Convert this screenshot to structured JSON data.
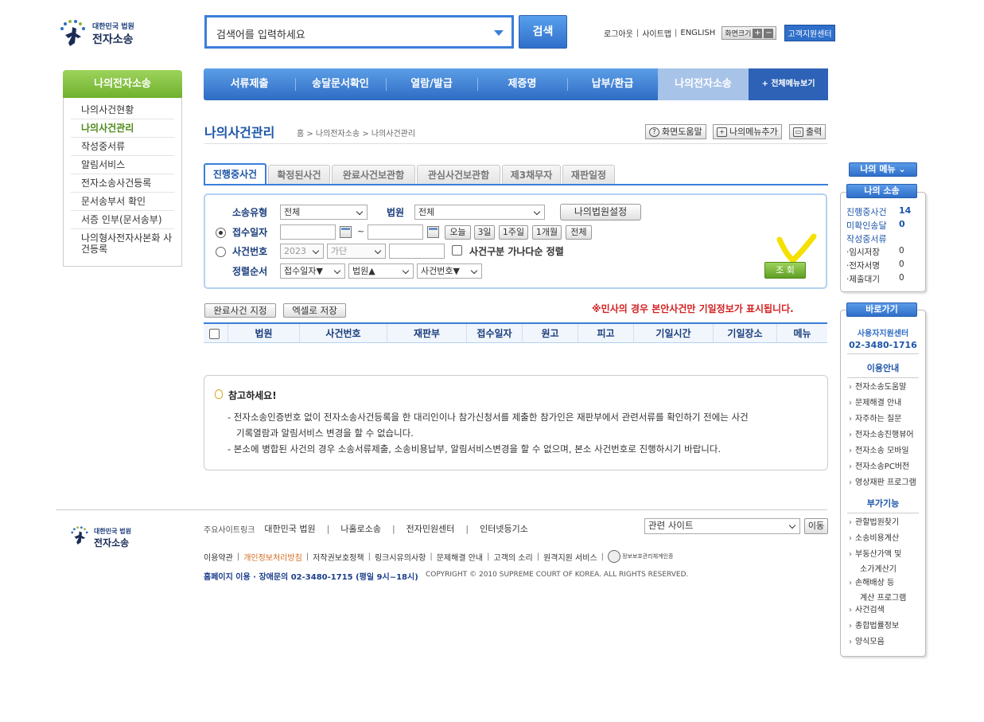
{
  "header": {
    "logo_top": "대한민국 법원",
    "logo_bottom": "전자소송",
    "search_placeholder": "검색어를 입력하세요",
    "search_button": "검색",
    "util": {
      "logout": "로그아웃",
      "sitemap": "사이트맵",
      "english": "ENGLISH",
      "zoom_label": "화면크기",
      "zoom_in": "+",
      "zoom_out": "−",
      "support": "고객지원센터"
    }
  },
  "gnb": {
    "items": [
      "서류제출",
      "송달문서확인",
      "열람/발급",
      "제증명",
      "납부/환급",
      "나의전자소송"
    ],
    "all_menu": "+ 전체메뉴보기"
  },
  "left_nav": {
    "title": "나의전자소송",
    "items": [
      "나의사건현황",
      "나의사건관리",
      "작성중서류",
      "알림서비스",
      "전자소송사건등록",
      "문서송부서 확인",
      "서증 인부(문서송부)",
      "나의형사전자사본화 사건등록"
    ]
  },
  "page": {
    "title": "나의사건관리",
    "breadcrumb": "홈 > 나의전자소송 > 나의사건관리",
    "help_button": "화면도움말",
    "add_menu_button": "나의메뉴추가",
    "print_button": "출력"
  },
  "tabs": [
    "진행중사건",
    "확정된사건",
    "완료사건보관함",
    "관심사건보관함",
    "제3채무자",
    "재판일정"
  ],
  "search_form": {
    "case_type_label": "소송유형",
    "case_type_value": "전체",
    "court_label": "법원",
    "court_value": "전체",
    "my_court_button": "나의법원설정",
    "receipt_date_label": "접수일자",
    "tilde": "~",
    "period_buttons": [
      "오늘",
      "3일",
      "1주일",
      "1개월",
      "전체"
    ],
    "case_no_label": "사건번호",
    "year_value": "2023",
    "case_code_value": "가단",
    "sort_check_label": "사건구분 가나다순 정렬",
    "sort_label": "정렬순서",
    "sort1": "접수일자▼",
    "sort2": "법원▲",
    "sort3": "사건번호▼",
    "lookup_button": "조 회"
  },
  "list": {
    "complete_button": "완료사건 지정",
    "excel_button": "엑셀로 저장",
    "notice": "※민사의 경우 본안사건만 기일정보가 표시됩니다.",
    "columns": [
      "법원",
      "사건번호",
      "재판부",
      "접수일자",
      "원고",
      "피고",
      "기일시간",
      "기일장소",
      "메뉴"
    ]
  },
  "info_box": {
    "title": "참고하세요!",
    "line1": "- 전자소송인증번호 없이 전자소송사건등록을 한 대리인이나 참가신청서를 제출한 참가인은 재판부에서 관련서류를 확인하기 전에는 사건",
    "line1b": "기록열람과 알림서비스 변경을 할 수 없습니다.",
    "line2": "- 본소에 병합된 사건의 경우 소송서류제출, 소송비용납부, 알림서비스변경을 할 수 없으며, 본소 사건번호로 진행하시기 바랍니다."
  },
  "right_panel": {
    "my_menu_button": "나의 메뉴 ⌄",
    "my_lawsuit_title": "나의 소송",
    "rows": [
      {
        "label": "진행중사건",
        "count": "14"
      },
      {
        "label": "미확인송달",
        "count": "0"
      },
      {
        "label": "작성중서류",
        "count": ""
      }
    ],
    "sub_rows": [
      {
        "label": "·임시저장",
        "count": "0"
      },
      {
        "label": "·전자서명",
        "count": "0"
      },
      {
        "label": "·제출대기",
        "count": "0"
      }
    ],
    "shortcut_title": "바로가기",
    "support_name": "사용자지원센터",
    "support_phone": "02-3480-1716",
    "guide_title": "이용안내",
    "guide_links": [
      "전자소송도움말",
      "문제해결 안내",
      "자주하는 질문",
      "전자소송진행뷰어",
      "전자소송 모바일",
      "전자소송PC버전",
      "영상재판 프로그램"
    ],
    "extra_title": "부가기능",
    "extra_links": [
      "관할법원찾기",
      "소송비용계산",
      "부동산가액 및",
      "소가계산기",
      "손해배상 등",
      "계산 프로그램",
      "사건검색",
      "종합법률정보",
      "양식모음"
    ]
  },
  "footer": {
    "logo_top": "대한민국 법원",
    "logo_bottom": "전자소송",
    "sites_label": "주요사이트링크",
    "sites": [
      "대한민국 법원",
      "나홀로소송",
      "전자민원센터",
      "인터넷등기소"
    ],
    "related_select": "관련 사이트",
    "go_button": "이동",
    "links": [
      "이용약관",
      "개인정보처리방침",
      "저작권보호정책",
      "링크시유의사항",
      "문제해결 안내",
      "고객의 소리",
      "원격지원 서비스"
    ],
    "cert_label": "정보보호관리체계인증",
    "contact": "홈페이지 이용 · 장애문의  02-3480-1715  (평일 9시~18시)",
    "copyright": "COPYRIGHT © 2010 SUPREME COURT OF KOREA. ALL RIGHTS RESERVED."
  }
}
